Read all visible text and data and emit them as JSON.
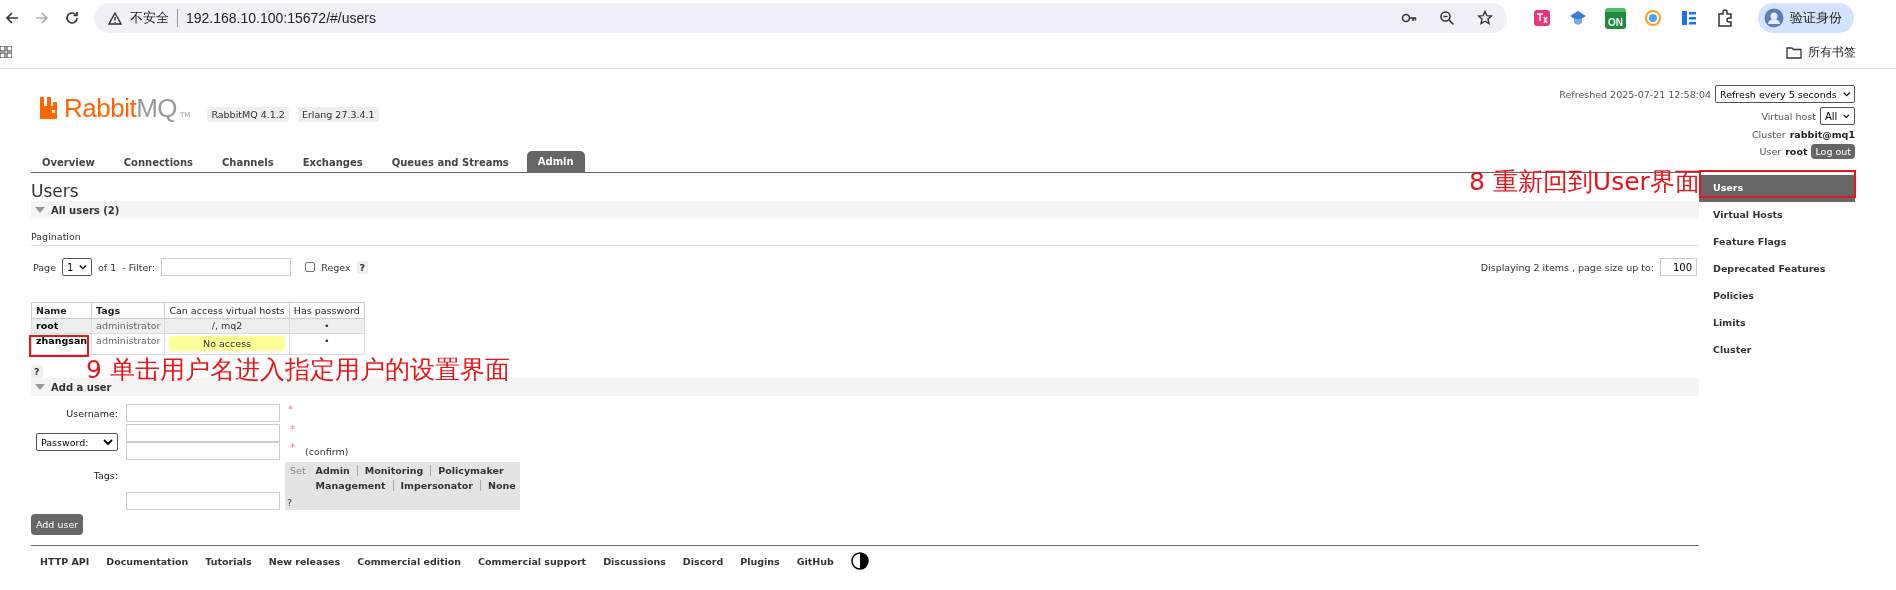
{
  "browser": {
    "security_label": "不安全",
    "url": "192.168.10.100:15672/#/users",
    "extension_badge": "ON",
    "profile_label": "验证身份",
    "bookmarks_label": "所有书签"
  },
  "header": {
    "logo": {
      "name_first": "Rabbit",
      "name_second": "MQ",
      "trademark": "TM"
    },
    "versions": [
      "RabbitMQ 4.1.2",
      "Erlang 27.3.4.1"
    ],
    "refreshed": "Refreshed 2025-07-21 12:58:04",
    "refresh_select": "Refresh every 5 seconds",
    "vhost_label": "Virtual host",
    "vhost_select": "All",
    "cluster_label": "Cluster",
    "cluster_name": "rabbit@mq1",
    "user_label": "User",
    "user_name": "root",
    "logout": "Log out"
  },
  "tabs": [
    {
      "label": "Overview",
      "selected": false
    },
    {
      "label": "Connections",
      "selected": false
    },
    {
      "label": "Channels",
      "selected": false
    },
    {
      "label": "Exchanges",
      "selected": false
    },
    {
      "label": "Queues and Streams",
      "selected": false
    },
    {
      "label": "Admin",
      "selected": true
    }
  ],
  "sidebar": {
    "items": [
      {
        "label": "Users",
        "selected": true
      },
      {
        "label": "Virtual Hosts",
        "selected": false
      },
      {
        "label": "Feature Flags",
        "selected": false
      },
      {
        "label": "Deprecated Features",
        "selected": false
      },
      {
        "label": "Policies",
        "selected": false
      },
      {
        "label": "Limits",
        "selected": false
      },
      {
        "label": "Cluster",
        "selected": false
      }
    ]
  },
  "page": {
    "title": "Users",
    "all_users": {
      "title": "All users (2)",
      "expanded": true,
      "pagination_label": "Pagination",
      "page_label": "Page",
      "page_select": "1",
      "of_label": "of 1",
      "filter_label": "- Filter:",
      "regex": {
        "label": "Regex",
        "checked": false,
        "help": "?"
      },
      "display_text": "Displaying 2 items , page size up to:",
      "page_size": "100",
      "table": {
        "columns": [
          "Name",
          "Tags",
          "Can access virtual hosts",
          "Has password"
        ],
        "rows": [
          {
            "name": "root",
            "tags": "administrator",
            "vhosts": {
              "text": "/, mq2",
              "kind": "plain"
            },
            "has_password": "•"
          },
          {
            "name": "zhangsan",
            "tags": "administrator",
            "vhosts": {
              "text": "No access",
              "kind": "warning"
            },
            "has_password": "•"
          }
        ]
      },
      "help": "?"
    },
    "add_user": {
      "title": "Add a user",
      "expanded": true,
      "username_label": "Username:",
      "username_marker": "*",
      "password_select": "Password:",
      "password_marker": "*",
      "confirm_marker": "*",
      "confirm_label": "(confirm)",
      "tags_label": "Tags:",
      "set_label": "Set",
      "tag_rows": [
        [
          "Admin",
          "Monitoring",
          "Policymaker"
        ],
        [
          "Management",
          "Impersonator",
          "None"
        ]
      ],
      "tags_help": "?",
      "submit": "Add user"
    }
  },
  "footer": {
    "links": [
      "HTTP API",
      "Documentation",
      "Tutorials",
      "New releases",
      "Commercial edition",
      "Commercial support",
      "Discussions",
      "Discord",
      "Plugins",
      "GitHub"
    ]
  },
  "annotations": [
    {
      "text": "8 重新回到User界面"
    },
    {
      "text": "9 单击用户名进入指定用户的设置界面"
    }
  ]
}
